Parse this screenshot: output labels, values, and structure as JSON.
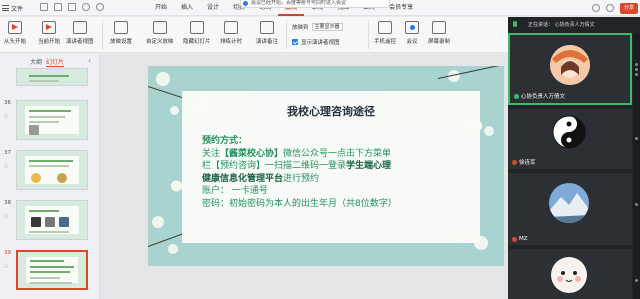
{
  "menu": {
    "file": "文件",
    "tabs": [
      "开始",
      "插入",
      "设计",
      "切换",
      "动画",
      "放映",
      "审阅",
      "视图",
      "工具",
      "会员专享"
    ],
    "active_tab_index": 5,
    "notice": "会议已经开始，百度等账号可同时进入会议",
    "share": "分享"
  },
  "ribbon": {
    "from_start": "从头开始",
    "from_current": "当前开始",
    "presenter_view": "演讲者视图",
    "show_settings": "放映设置",
    "custom_show": "自定义放映",
    "hide_slide": "隐藏幻灯片",
    "rehearse": "排练计时",
    "presenter_notes": "演讲备注",
    "display_to": "放映到",
    "monitor": "主要显示器",
    "show_presenter": "显示演讲者视图",
    "phone_remote": "手机遥控",
    "meeting": "会议",
    "screen_record": "屏幕录制"
  },
  "left_panel": {
    "tab_outline": "大纲",
    "tab_slides": "幻灯片",
    "slide_numbers": [
      "36",
      "37",
      "38",
      "39"
    ],
    "selected": "39"
  },
  "slide": {
    "title": "我校心理咨询途径",
    "heading": "预约方式：",
    "line1_a": "关注",
    "line1_b": "【酱菜校心协】",
    "line1_c": "微信公众号一点击下方菜单",
    "line2_a": "栏【预约咨询】一扫描二维码一登录",
    "line2_b": "学生端心理",
    "line3": "健康信息化管理平台",
    "line3_b": "进行预约",
    "line4": "账户：  一卡通号",
    "line5": "密码：初始密码为本人的出生年月（共8位数字）"
  },
  "meeting": {
    "speaking": "正在讲话：  心协负责人万倩文",
    "participants": [
      {
        "name": "心协负责人万倩文"
      },
      {
        "name": "徐连军"
      },
      {
        "name": "MZ"
      },
      {
        "name": ""
      }
    ]
  },
  "colors": {
    "accent": "#d9482b",
    "slide_green": "#1f8f57",
    "meeting_bg": "#222528",
    "speaking_green": "#3ebb6a"
  }
}
